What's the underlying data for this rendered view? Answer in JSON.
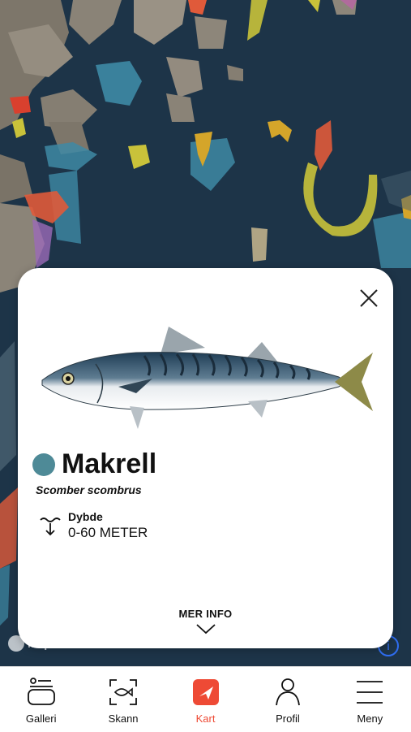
{
  "map": {
    "attribution": "mapbox",
    "info_label": "i"
  },
  "card": {
    "species_name": "Makrell",
    "latin_name": "Scomber scombrus",
    "depth_label": "Dybde",
    "depth_value": "0-60 METER",
    "more_info_label": "MER INFO",
    "dot_color": "#4e8a97"
  },
  "tabs": [
    {
      "label": "Galleri",
      "icon": "gallery-icon",
      "active": false
    },
    {
      "label": "Skann",
      "icon": "scan-fish-icon",
      "active": false
    },
    {
      "label": "Kart",
      "icon": "map-icon",
      "active": true
    },
    {
      "label": "Profil",
      "icon": "profile-icon",
      "active": false
    },
    {
      "label": "Meny",
      "icon": "menu-icon",
      "active": false
    }
  ],
  "colors": {
    "accent": "#ee4a35",
    "sea": "#1d3448",
    "info_blue": "#2f6df0"
  }
}
